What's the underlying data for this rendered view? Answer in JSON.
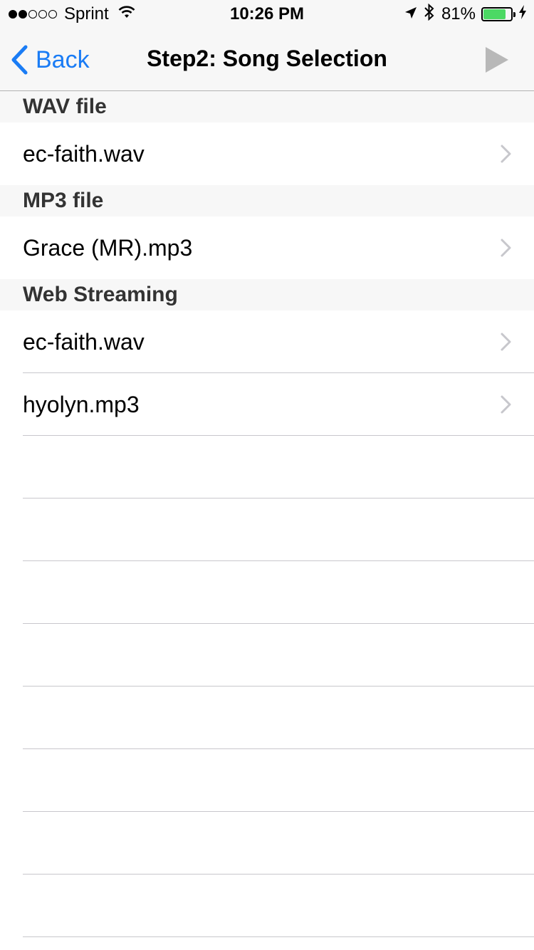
{
  "status_bar": {
    "carrier": "Sprint",
    "signal_dots": [
      true,
      true,
      false,
      false,
      false
    ],
    "time": "10:26 PM",
    "battery_percent": "81%",
    "battery_level": 0.81,
    "battery_color": "#4cd964",
    "icons": [
      "wifi-icon",
      "location-arrow-icon",
      "bluetooth-icon",
      "battery-icon",
      "charging-bolt-icon"
    ]
  },
  "nav": {
    "back_label": "Back",
    "title": "Step2: Song Selection",
    "accent_color": "#1a7cf5",
    "play_icon": "play-icon"
  },
  "sections": [
    {
      "header": "WAV file",
      "rows": [
        {
          "label": "ec-faith.wav"
        }
      ]
    },
    {
      "header": "MP3 file",
      "rows": [
        {
          "label": "Grace (MR).mp3"
        }
      ]
    },
    {
      "header": "Web Streaming",
      "rows": [
        {
          "label": "ec-faith.wav"
        },
        {
          "label": "hyolyn.mp3"
        }
      ]
    }
  ]
}
